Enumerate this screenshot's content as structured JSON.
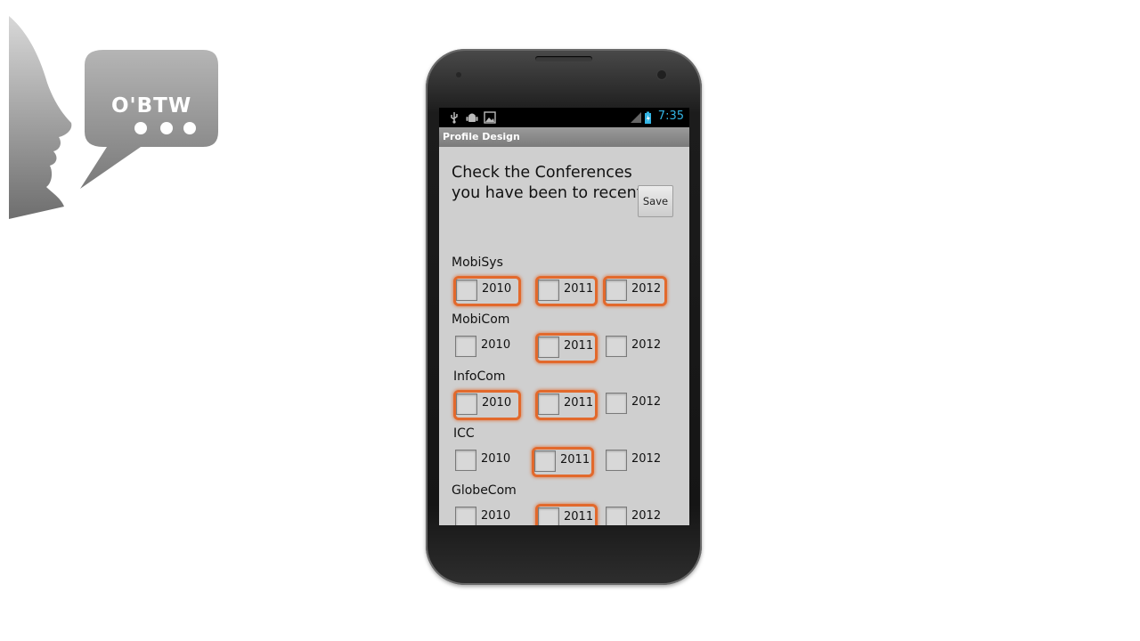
{
  "logo": {
    "text": "O'BTW"
  },
  "status_bar": {
    "time": "7:35",
    "icons": [
      "usb-icon",
      "android-debug-icon",
      "image-icon",
      "signal-icon",
      "battery-charging-icon"
    ]
  },
  "app": {
    "title": "Profile Design",
    "heading": "Check the Conferences you have been to recently",
    "save_label": "Save"
  },
  "colors": {
    "highlight": "#e2692c",
    "clock": "#33b5e5",
    "screen_bg": "#cfcfcf"
  },
  "conferences": [
    {
      "name": "MobiSys",
      "years": [
        {
          "label": "2010",
          "highlighted": true
        },
        {
          "label": "2011",
          "highlighted": true
        },
        {
          "label": "2012",
          "highlighted": true
        }
      ]
    },
    {
      "name": "MobiCom",
      "years": [
        {
          "label": "2010",
          "highlighted": false
        },
        {
          "label": "2011",
          "highlighted": true
        },
        {
          "label": "2012",
          "highlighted": false
        }
      ]
    },
    {
      "name": "InfoCom",
      "years": [
        {
          "label": "2010",
          "highlighted": true
        },
        {
          "label": "2011",
          "highlighted": true
        },
        {
          "label": "2012",
          "highlighted": false
        }
      ]
    },
    {
      "name": "ICC",
      "years": [
        {
          "label": "2010",
          "highlighted": false
        },
        {
          "label": "2011",
          "highlighted": true
        },
        {
          "label": "2012",
          "highlighted": false
        }
      ]
    },
    {
      "name": "GlobeCom",
      "years": [
        {
          "label": "2010",
          "highlighted": false
        },
        {
          "label": "2011",
          "highlighted": true
        },
        {
          "label": "2012",
          "highlighted": false
        }
      ]
    }
  ]
}
